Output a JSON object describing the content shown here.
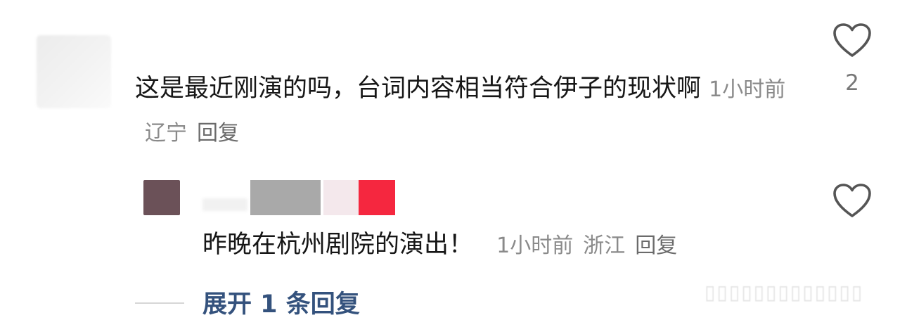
{
  "comment": {
    "text": "这是最近刚演的吗，台词内容相当符合伊子的现状啊",
    "time": "1小时前",
    "location": "辽宁",
    "reply_label": "回复",
    "like_count": "2"
  },
  "reply": {
    "text": "昨晚在杭州剧院的演出！",
    "time": "1小时前",
    "location": "浙江",
    "reply_label": "回复"
  },
  "expand_label": "展开 1 条回复",
  "icons": {
    "like": "heart-outline-icon"
  },
  "colors": {
    "text": "#161616",
    "meta": "#8a8a8a",
    "link": "#34527d",
    "heart": "#555555"
  }
}
